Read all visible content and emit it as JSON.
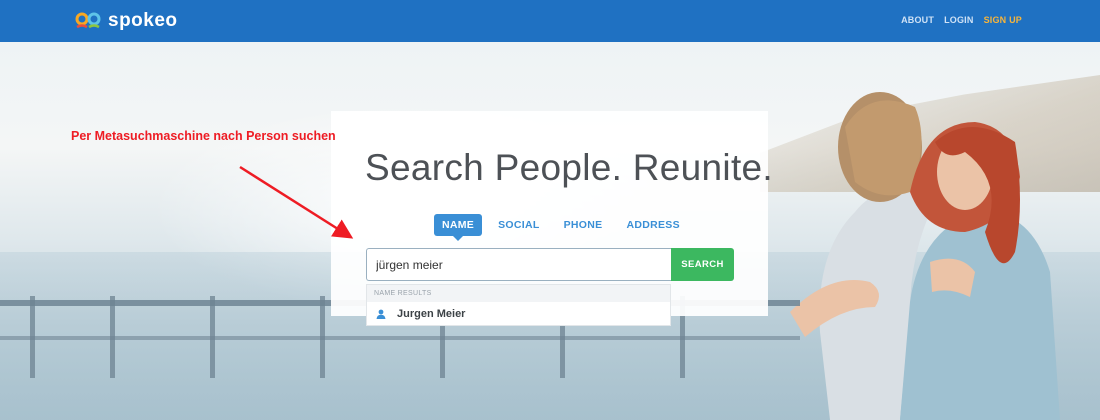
{
  "header": {
    "logo_text": "spokeo",
    "nav": {
      "about": "ABOUT",
      "login": "LOGIN",
      "signup": "SIGN UP"
    }
  },
  "hero": {
    "headline": "Search People. Reunite.",
    "tabs": [
      {
        "label": "NAME",
        "active": true
      },
      {
        "label": "SOCIAL",
        "active": false
      },
      {
        "label": "PHONE",
        "active": false
      },
      {
        "label": "ADDRESS",
        "active": false
      }
    ],
    "search": {
      "value": "jürgen meier",
      "button_label": "SEARCH"
    },
    "dropdown": {
      "header": "NAME RESULTS",
      "items": [
        {
          "label": "Jurgen Meier",
          "icon": "person-icon"
        }
      ]
    }
  },
  "annotation": {
    "text": "Per Metasuchmaschine nach Person suchen"
  },
  "colors": {
    "header_bg": "#1f71c2",
    "accent_blue": "#3a8fd6",
    "search_green": "#3cb860",
    "signup_orange": "#f7b53b",
    "annotation_red": "#ee1c24"
  }
}
